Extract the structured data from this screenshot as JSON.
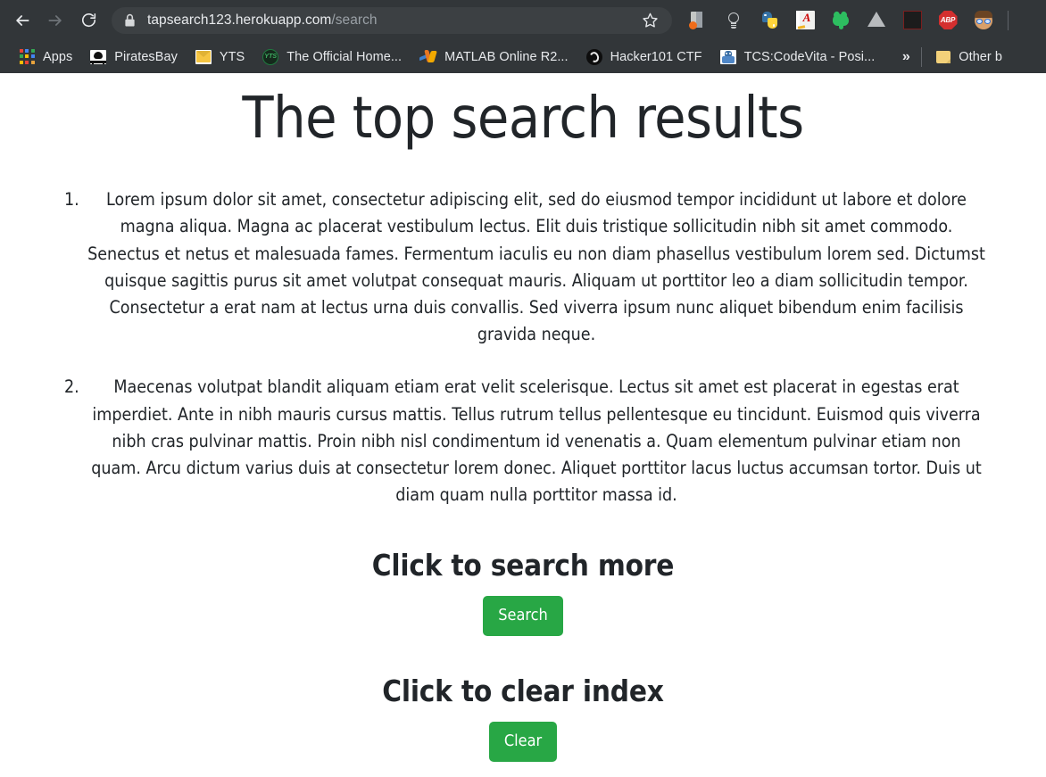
{
  "browser": {
    "nav": {
      "back_label": "Back",
      "forward_label": "Forward",
      "reload_label": "Reload"
    },
    "omnibox": {
      "lock_label": "Secure",
      "url_host": "tapsearch123.herokuapp.com",
      "url_path": "/search",
      "star_label": "Bookmark this tab"
    },
    "extensions": [
      {
        "name": "onetab-icon",
        "label": "OneTab"
      },
      {
        "name": "lightbulb-icon",
        "label": "Idea"
      },
      {
        "name": "python-icon",
        "label": "Python"
      },
      {
        "name": "dictionary-icon",
        "label": "Dictionary"
      },
      {
        "name": "evernote-icon",
        "label": "Evernote Web Clipper"
      },
      {
        "name": "google-drive-icon",
        "label": "Save to Google Drive"
      },
      {
        "name": "adobe-acrobat-icon",
        "label": "Adobe Acrobat"
      },
      {
        "name": "adblock-plus-icon",
        "label": "ABP"
      },
      {
        "name": "profile-avatar-icon",
        "label": "Profile"
      }
    ],
    "bookmarks": [
      {
        "icon": "apps-grid-icon",
        "label": "Apps"
      },
      {
        "icon": "piratesbay-icon",
        "label": "PiratesBay"
      },
      {
        "icon": "yts-envelope-icon",
        "label": "YTS"
      },
      {
        "icon": "yts-green-icon",
        "label": "The Official Home..."
      },
      {
        "icon": "matlab-icon",
        "label": "MATLAB Online R2..."
      },
      {
        "icon": "hacker101-icon",
        "label": "Hacker101 CTF"
      },
      {
        "icon": "tcs-codevita-icon",
        "label": "TCS:CodeVita - Posi..."
      }
    ],
    "bookmarks_overflow_label": "»",
    "other_bookmarks_label": "Other b"
  },
  "page": {
    "title": "The top search results",
    "results": [
      "Lorem ipsum dolor sit amet, consectetur adipiscing elit, sed do eiusmod tempor incididunt ut labore et dolore magna aliqua. Magna ac placerat vestibulum lectus. Elit duis tristique sollicitudin nibh sit amet commodo. Senectus et netus et malesuada fames. Fermentum iaculis eu non diam phasellus vestibulum lorem sed. Dictumst quisque sagittis purus sit amet volutpat consequat mauris. Aliquam ut porttitor leo a diam sollicitudin tempor. Consectetur a erat nam at lectus urna duis convallis. Sed viverra ipsum nunc aliquet bibendum enim facilisis gravida neque.",
      "Maecenas volutpat blandit aliquam etiam erat velit scelerisque. Lectus sit amet est placerat in egestas erat imperdiet. Ante in nibh mauris cursus mattis. Tellus rutrum tellus pellentesque eu tincidunt. Euismod quis viverra nibh cras pulvinar mattis. Proin nibh nisl condimentum id venenatis a. Quam elementum pulvinar etiam non quam. Arcu dictum varius duis at consectetur lorem donec. Aliquet porttitor lacus luctus accumsan tortor. Duis ut diam quam nulla porttitor massa id."
    ],
    "search_section": {
      "heading": "Click to search more",
      "button_label": "Search"
    },
    "clear_section": {
      "heading": "Click to clear index",
      "button_label": "Clear"
    }
  },
  "colors": {
    "chrome_bg": "#323639",
    "omnibox_bg": "#3c4043",
    "button_green": "#28a745",
    "page_text": "#212529",
    "url_path_grey": "#9aa0a6"
  }
}
